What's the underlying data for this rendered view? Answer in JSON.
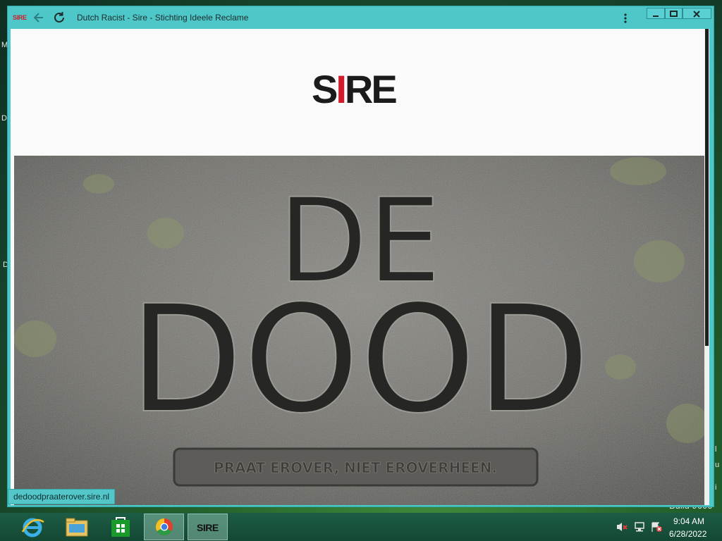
{
  "desktop": {
    "hints": [
      "M",
      "D",
      "D",
      "l",
      "u",
      "i"
    ],
    "build_text": "Build 9600"
  },
  "window": {
    "title": "Dutch Racist - Sire - Stichting Ideele Reclame",
    "favicon_text": "SIRE",
    "icons": {
      "back": "back-arrow-icon",
      "reload": "reload-icon",
      "menu": "kebab-menu-icon",
      "minimize": "minimize-icon",
      "maximize": "maximize-icon",
      "close": "close-icon"
    },
    "accent_color": "#4ec7c9"
  },
  "page": {
    "logo": {
      "left": "S",
      "bar": "I",
      "right": "RE",
      "bar_color": "#d01c2c"
    },
    "hero": {
      "line1": "DE",
      "line2": "DOOD",
      "tagline": "PRAAT EROVER, NIET EROVERHEEN."
    },
    "status_url": "dedoodpraaterover.sire.nl"
  },
  "taskbar": {
    "items": [
      {
        "name": "internet-explorer-icon",
        "active": false
      },
      {
        "name": "file-explorer-icon",
        "active": false
      },
      {
        "name": "windows-store-icon",
        "active": false
      },
      {
        "name": "chrome-icon",
        "active": true
      },
      {
        "name": "sire-app-icon",
        "label": "SIRE",
        "active": true
      }
    ],
    "tray": [
      "volume-muted-icon",
      "network-icon",
      "action-center-flag-icon"
    ],
    "time": "9:04 AM",
    "date": "6/28/2022"
  }
}
